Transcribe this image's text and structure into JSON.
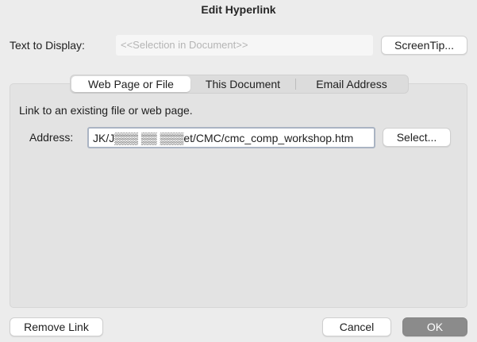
{
  "window": {
    "title": "Edit Hyperlink"
  },
  "display": {
    "label": "Text to Display:",
    "placeholder": "<<Selection in Document>>",
    "screentip_label": "ScreenTip..."
  },
  "tabs": [
    {
      "label": "Web Page or File",
      "selected": true
    },
    {
      "label": "This Document",
      "selected": false
    },
    {
      "label": "Email Address",
      "selected": false
    }
  ],
  "panel": {
    "description": "Link to an existing file or web page.",
    "address_label": "Address:",
    "address_value": "JK/J▒▒▒ ▒▒ ▒▒▒et/CMC/cmc_comp_workshop.htm",
    "select_label": "Select..."
  },
  "footer": {
    "remove_label": "Remove Link",
    "cancel_label": "Cancel",
    "ok_label": "OK"
  },
  "colors": {
    "background": "#ececec",
    "ok_button": "#8b8b8b",
    "address_focus_border": "#aab4c3"
  }
}
